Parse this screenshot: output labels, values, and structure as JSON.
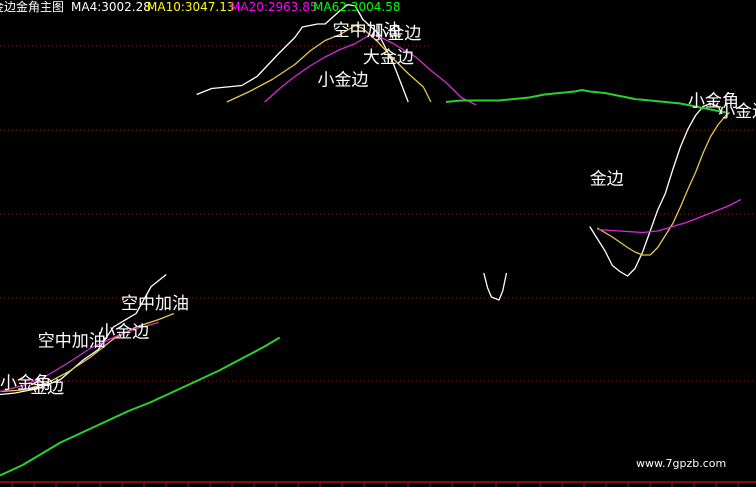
{
  "header": {
    "indicator_name": "金边金角主图",
    "items": [
      {
        "text": "MA4:3002.28",
        "color": "#ffffff"
      },
      {
        "text": "MA10:3047.13",
        "color": "#ffff00"
      },
      {
        "text": "MA20:2963.85",
        "color": "#ff00ff"
      },
      {
        "text": "MA62:3004.58",
        "color": "#00ff00"
      }
    ]
  },
  "watermark": "www.7gpzb.com",
  "colors": {
    "background": "#000000",
    "grid": "#a01414",
    "axis": "#a01414",
    "ma4": "#ffffff",
    "ma10": "#e6c84a",
    "ma20": "#d42cd4",
    "ma62": "#2ad12a",
    "annotation": "#ffffff"
  },
  "chart_data": {
    "type": "line",
    "title": "",
    "xlabel": "",
    "ylabel": "",
    "xlim": [
      0,
      100
    ],
    "ylim": [
      2830,
      3150
    ],
    "grid": true,
    "legend": "top-left",
    "series": [
      {
        "name": "MA4",
        "color": "#ffffff",
        "segments": [
          [
            [
              0,
              2887
            ],
            [
              2,
              2888
            ],
            [
              5,
              2891
            ],
            [
              8,
              2897
            ],
            [
              11,
              2910
            ],
            [
              13,
              2917
            ],
            [
              15,
              2932
            ],
            [
              18,
              2941
            ],
            [
              20,
              2959
            ],
            [
              22,
              2967
            ]
          ],
          [
            [
              26,
              3087
            ],
            [
              28,
              3091
            ],
            [
              30,
              3092
            ],
            [
              32,
              3093
            ],
            [
              34,
              3099
            ],
            [
              37,
              3115
            ],
            [
              39,
              3125
            ],
            [
              40,
              3132
            ],
            [
              42,
              3134
            ],
            [
              43,
              3134
            ],
            [
              45,
              3143
            ],
            [
              46,
              3147
            ],
            [
              47,
              3146
            ],
            [
              48,
              3137
            ],
            [
              50,
              3128
            ],
            [
              52,
              3108
            ],
            [
              53,
              3095
            ],
            [
              54,
              3082
            ]
          ],
          [
            [
              64,
              2968
            ],
            [
              64.5,
              2958
            ],
            [
              65,
              2952
            ],
            [
              66,
              2950
            ],
            [
              66.5,
              2956
            ],
            [
              67,
              2968
            ]
          ],
          [
            [
              78,
              2999
            ],
            [
              79,
              2991
            ],
            [
              80,
              2983
            ],
            [
              81,
              2973
            ],
            [
              82,
              2969
            ],
            [
              83,
              2966
            ],
            [
              84,
              2971
            ],
            [
              85,
              2982
            ],
            [
              86,
              2996
            ],
            [
              87,
              3010
            ],
            [
              88,
              3021
            ],
            [
              89,
              3037
            ],
            [
              90,
              3052
            ],
            [
              91,
              3064
            ],
            [
              92,
              3073
            ],
            [
              93,
              3079
            ],
            [
              94,
              3081
            ],
            [
              95,
              3079
            ],
            [
              95.5,
              3074
            ]
          ]
        ]
      },
      {
        "name": "MA10",
        "color": "#e6c84a",
        "segments": [
          [
            [
              0,
              2889
            ],
            [
              3,
              2890
            ],
            [
              6,
              2894
            ],
            [
              9,
              2902
            ],
            [
              12,
              2912
            ],
            [
              15,
              2924
            ],
            [
              18,
              2932
            ],
            [
              21,
              2937
            ],
            [
              23,
              2941
            ]
          ],
          [
            [
              30,
              3082
            ],
            [
              33,
              3089
            ],
            [
              36,
              3097
            ],
            [
              39,
              3107
            ],
            [
              41,
              3116
            ],
            [
              43,
              3123
            ],
            [
              45,
              3127
            ],
            [
              47,
              3133
            ],
            [
              48,
              3131
            ],
            [
              50,
              3122
            ],
            [
              52,
              3111
            ],
            [
              54,
              3101
            ],
            [
              56,
              3092
            ],
            [
              57,
              3082
            ]
          ],
          [
            [
              79,
              2998
            ],
            [
              81,
              2992
            ],
            [
              83,
              2985
            ],
            [
              84,
              2982
            ],
            [
              85,
              2980
            ],
            [
              86,
              2980
            ],
            [
              87,
              2985
            ],
            [
              88,
              2993
            ],
            [
              89,
              3001
            ],
            [
              90,
              3012
            ],
            [
              91,
              3024
            ],
            [
              92,
              3035
            ],
            [
              93,
              3048
            ],
            [
              94,
              3059
            ],
            [
              95,
              3067
            ],
            [
              96,
              3073
            ],
            [
              96.5,
              3075
            ]
          ]
        ]
      },
      {
        "name": "MA20",
        "color": "#d42cd4",
        "segments": [
          [
            [
              0,
              2889
            ],
            [
              3,
              2893
            ],
            [
              6,
              2899
            ],
            [
              9,
              2908
            ],
            [
              12,
              2918
            ],
            [
              15,
              2925
            ],
            [
              18,
              2931
            ],
            [
              21,
              2935
            ]
          ],
          [
            [
              35,
              3082
            ],
            [
              37,
              3091
            ],
            [
              39,
              3099
            ],
            [
              41,
              3106
            ],
            [
              43,
              3112
            ],
            [
              45,
              3117
            ],
            [
              47,
              3121
            ],
            [
              49,
              3127
            ],
            [
              50,
              3126
            ],
            [
              52,
              3121
            ],
            [
              55,
              3112
            ],
            [
              57,
              3103
            ],
            [
              59,
              3095
            ],
            [
              61,
              3085
            ],
            [
              63,
              3080
            ]
          ],
          [
            [
              79,
              2997
            ],
            [
              82,
              2996
            ],
            [
              85,
              2995
            ],
            [
              87,
              2996
            ],
            [
              89,
              2999
            ],
            [
              91,
              3002
            ],
            [
              93,
              3006
            ],
            [
              95,
              3010
            ],
            [
              96.5,
              3013
            ],
            [
              98,
              3017
            ]
          ]
        ]
      },
      {
        "name": "MA62",
        "color": "#2ad12a",
        "segments": [
          [
            [
              0,
              2833
            ],
            [
              3,
              2840
            ],
            [
              6,
              2849
            ],
            [
              8,
              2855
            ],
            [
              11,
              2862
            ],
            [
              14,
              2869
            ],
            [
              17,
              2876
            ],
            [
              20,
              2882
            ],
            [
              23,
              2889
            ],
            [
              26,
              2896
            ],
            [
              29,
              2903
            ],
            [
              32,
              2911
            ],
            [
              35,
              2919
            ],
            [
              37,
              2925
            ]
          ],
          [
            [
              59,
              3082
            ],
            [
              61,
              3083
            ],
            [
              63,
              3083
            ],
            [
              66,
              3083
            ],
            [
              68,
              3084
            ],
            [
              70,
              3085
            ],
            [
              72,
              3087
            ],
            [
              74,
              3088
            ],
            [
              76,
              3089
            ],
            [
              77,
              3090
            ],
            [
              78,
              3089
            ],
            [
              80,
              3088
            ],
            [
              82,
              3086
            ],
            [
              84,
              3084
            ],
            [
              86,
              3083
            ],
            [
              88,
              3082
            ],
            [
              90,
              3081
            ],
            [
              92,
              3079
            ],
            [
              94,
              3077
            ],
            [
              96,
              3075
            ]
          ]
        ]
      }
    ],
    "annotations": [
      {
        "text": "小金角",
        "x": 0,
        "y": 2891
      },
      {
        "text": "金边",
        "x": 4,
        "y": 2888
      },
      {
        "text": "空中加油",
        "x": 5,
        "y": 2919
      },
      {
        "text": "小金边",
        "x": 13,
        "y": 2925
      },
      {
        "text": "空中加油",
        "x": 16,
        "y": 2944
      },
      {
        "text": "空中加油",
        "x": 44,
        "y": 3126
      },
      {
        "text": "小金边",
        "x": 49,
        "y": 3124
      },
      {
        "text": "大金边",
        "x": 48,
        "y": 3108
      },
      {
        "text": "小金边",
        "x": 42,
        "y": 3093
      },
      {
        "text": "金边",
        "x": 78,
        "y": 3027
      },
      {
        "text": "小金角",
        "x": 91,
        "y": 3079
      },
      {
        "text": "小金边",
        "x": 95,
        "y": 3072
      }
    ]
  }
}
